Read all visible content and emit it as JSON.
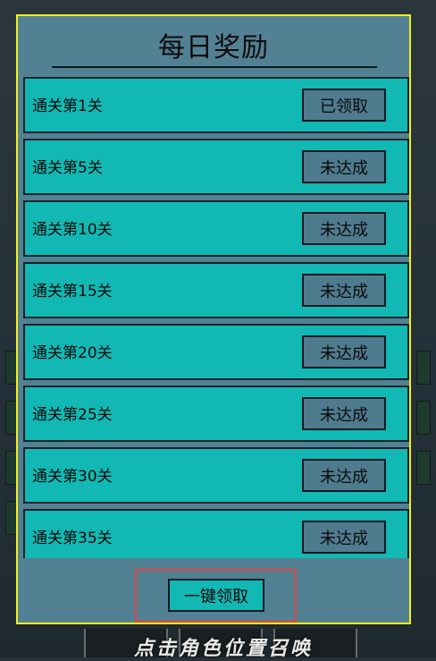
{
  "dialog": {
    "title": "每日奖励",
    "claim_all_label": "一键领取"
  },
  "rewards": [
    {
      "label": "通关第1关",
      "status": "已领取"
    },
    {
      "label": "通关第5关",
      "status": "未达成"
    },
    {
      "label": "通关第10关",
      "status": "未达成"
    },
    {
      "label": "通关第15关",
      "status": "未达成"
    },
    {
      "label": "通关第20关",
      "status": "未达成"
    },
    {
      "label": "通关第25关",
      "status": "未达成"
    },
    {
      "label": "通关第30关",
      "status": "未达成"
    },
    {
      "label": "通关第35关",
      "status": "未达成"
    }
  ],
  "background": {
    "caption": "点击角色位置召唤"
  },
  "colors": {
    "dialog_bg": "#538194",
    "dialog_border": "#f2ef1d",
    "row_bg": "#12b8b3",
    "button_bg": "#4f7b8f",
    "highlight": "#e0443d"
  }
}
